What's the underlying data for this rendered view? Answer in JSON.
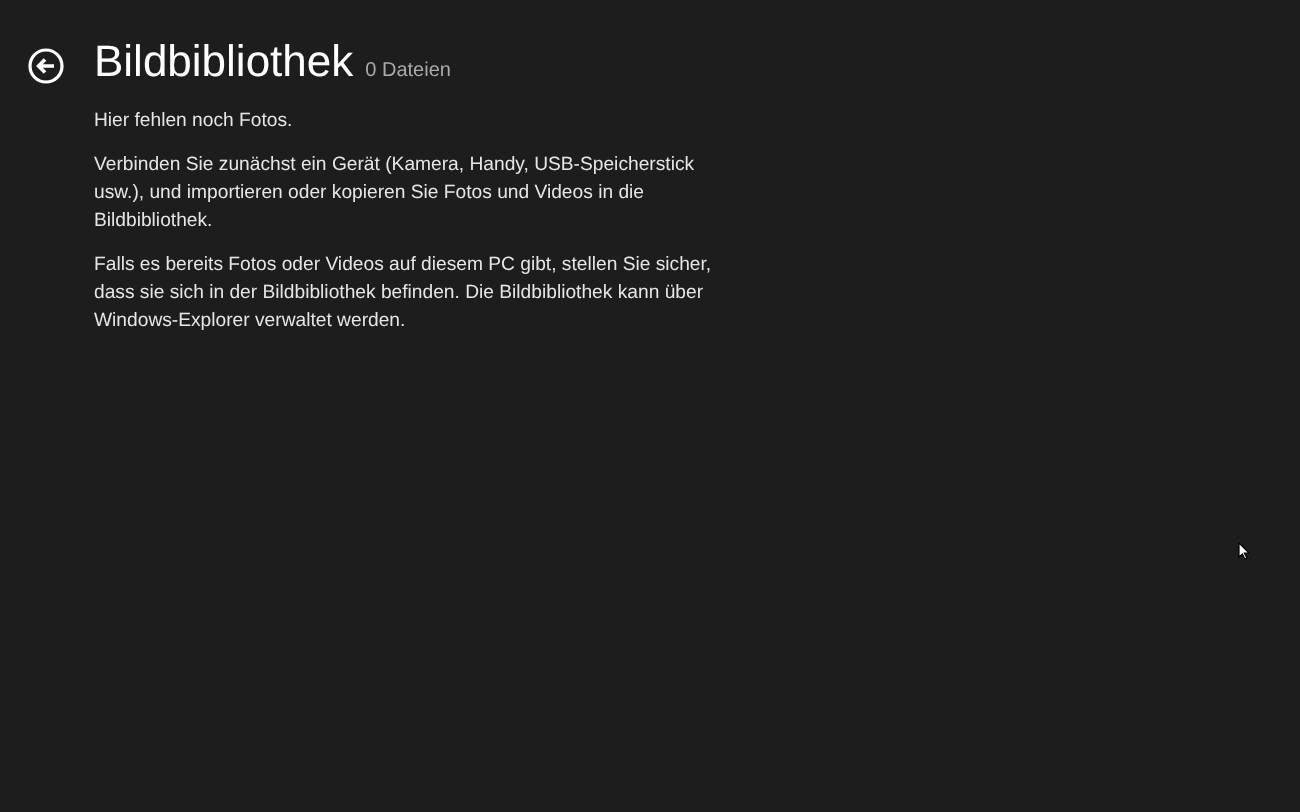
{
  "header": {
    "title": "Bildbibliothek",
    "count": "0 Dateien"
  },
  "paragraphs": [
    "Hier fehlen noch Fotos.",
    "Verbinden Sie zunächst ein Gerät (Kamera, Handy, USB-Speicherstick usw.), und importieren oder kopieren Sie Fotos und Videos in die Bildbibliothek.",
    "Falls es bereits Fotos oder Videos auf diesem PC gibt, stellen Sie sicher, dass sie sich in der Bildbibliothek befinden. Die Bildbibliothek kann über Windows-Explorer verwaltet werden."
  ]
}
